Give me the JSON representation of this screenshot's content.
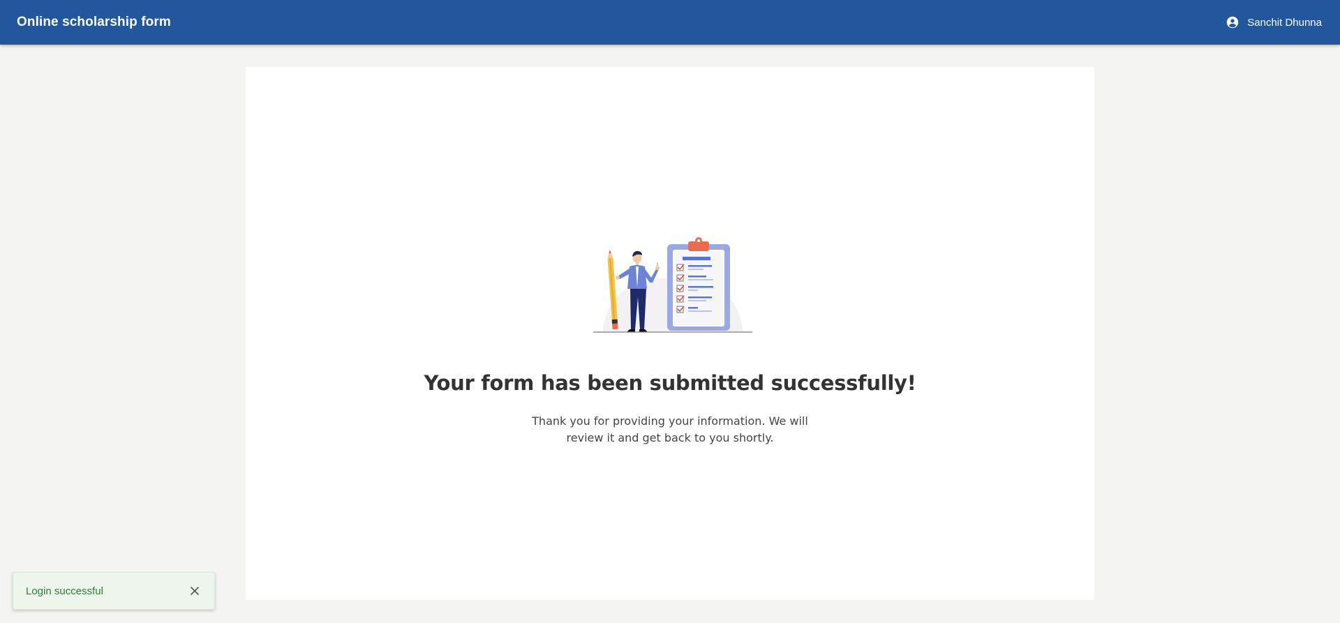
{
  "header": {
    "app_title": "Online scholarship form",
    "user_name": "Sanchit Dhunna",
    "user_icon": "account-circle-icon"
  },
  "main": {
    "title": "Your form has been submitted successfully!",
    "message": "Thank you for providing your information. We will review it and get back to you shortly."
  },
  "toast": {
    "message": "Login successful",
    "close_icon": "close-icon"
  },
  "colors": {
    "header_bg": "#22579e",
    "page_bg": "#f4f4f3",
    "toast_bg": "#edf5ec",
    "toast_text": "#2f7d32"
  }
}
